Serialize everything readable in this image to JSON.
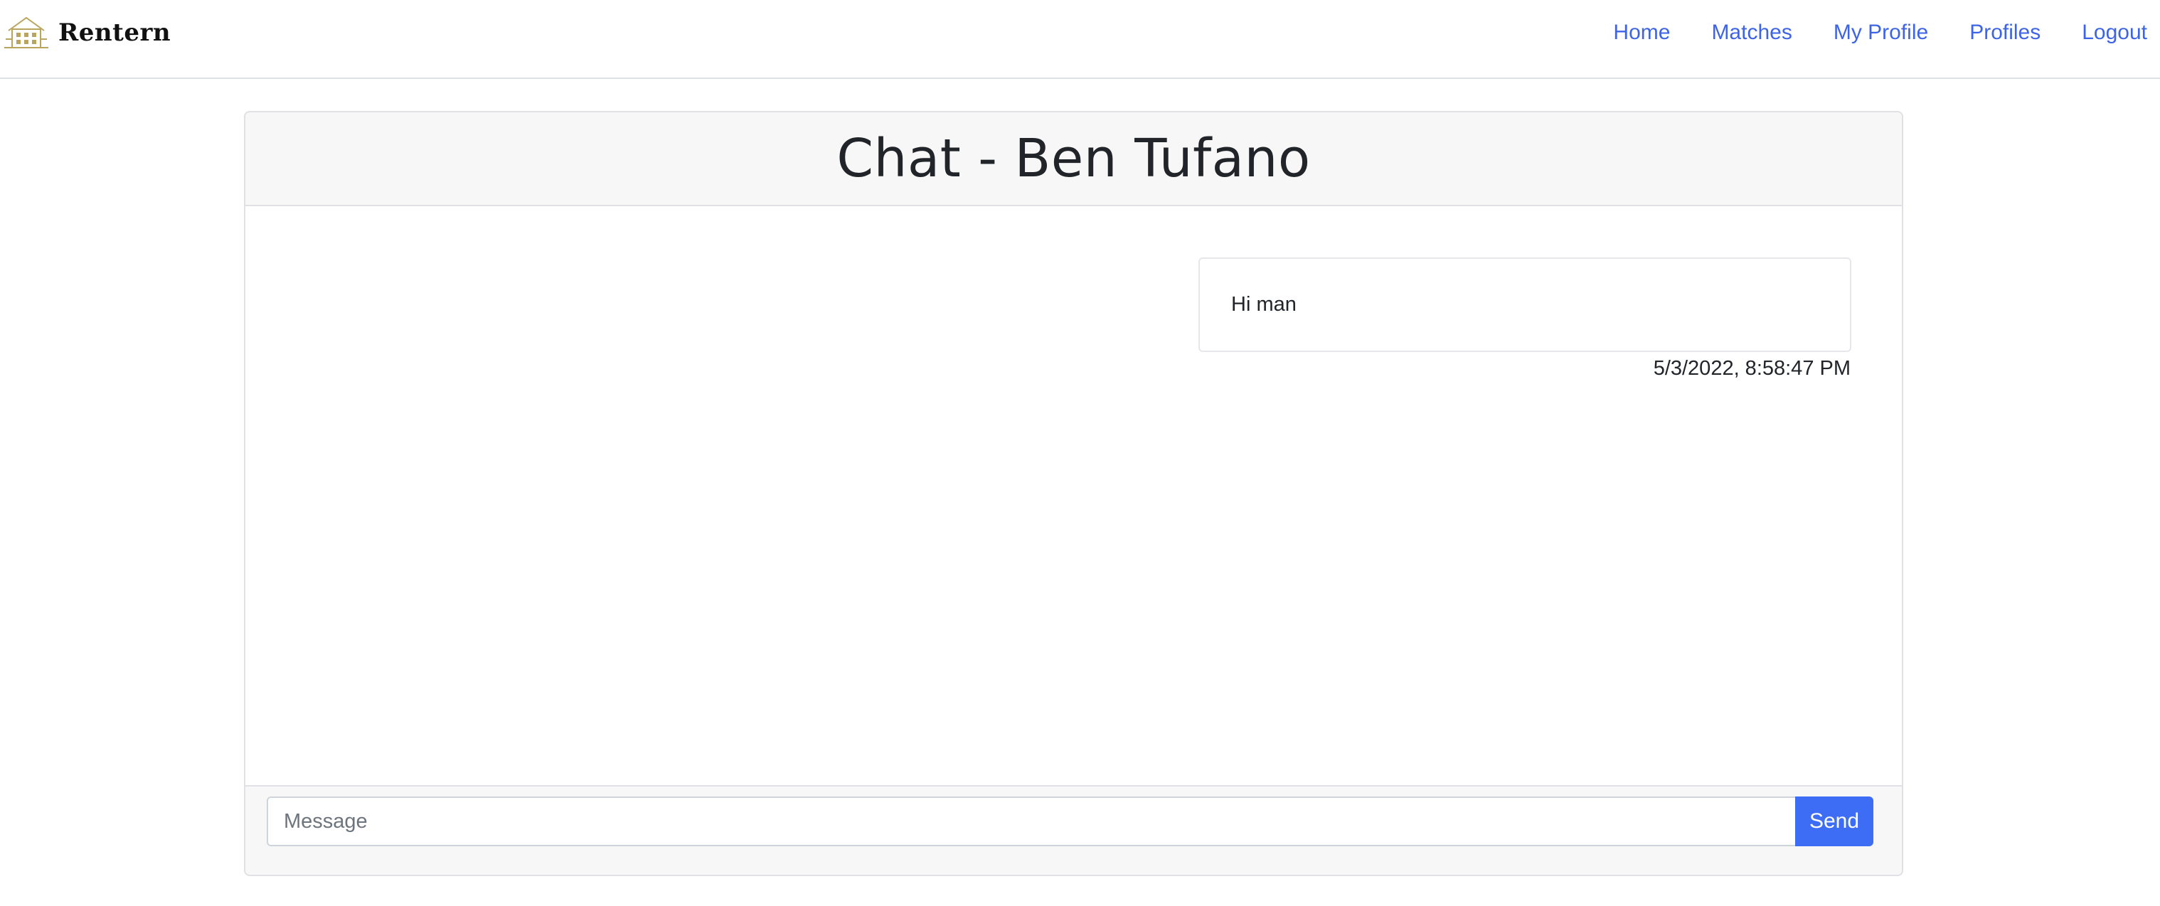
{
  "brand": {
    "name": "Rentern",
    "logo_icon": "house-logo-icon",
    "logo_color": "#b9a55e"
  },
  "nav": {
    "items": [
      {
        "label": "Home"
      },
      {
        "label": "Matches"
      },
      {
        "label": "My Profile"
      },
      {
        "label": "Profiles"
      },
      {
        "label": "Logout"
      }
    ],
    "link_color": "#3d64e6"
  },
  "chat": {
    "title": "Chat - Ben Tufano",
    "messages": [
      {
        "text": "Hi man",
        "timestamp": "5/3/2022, 8:58:47 PM"
      }
    ]
  },
  "composer": {
    "placeholder": "Message",
    "value": "",
    "send_label": "Send",
    "send_color": "#3d6cf5"
  }
}
